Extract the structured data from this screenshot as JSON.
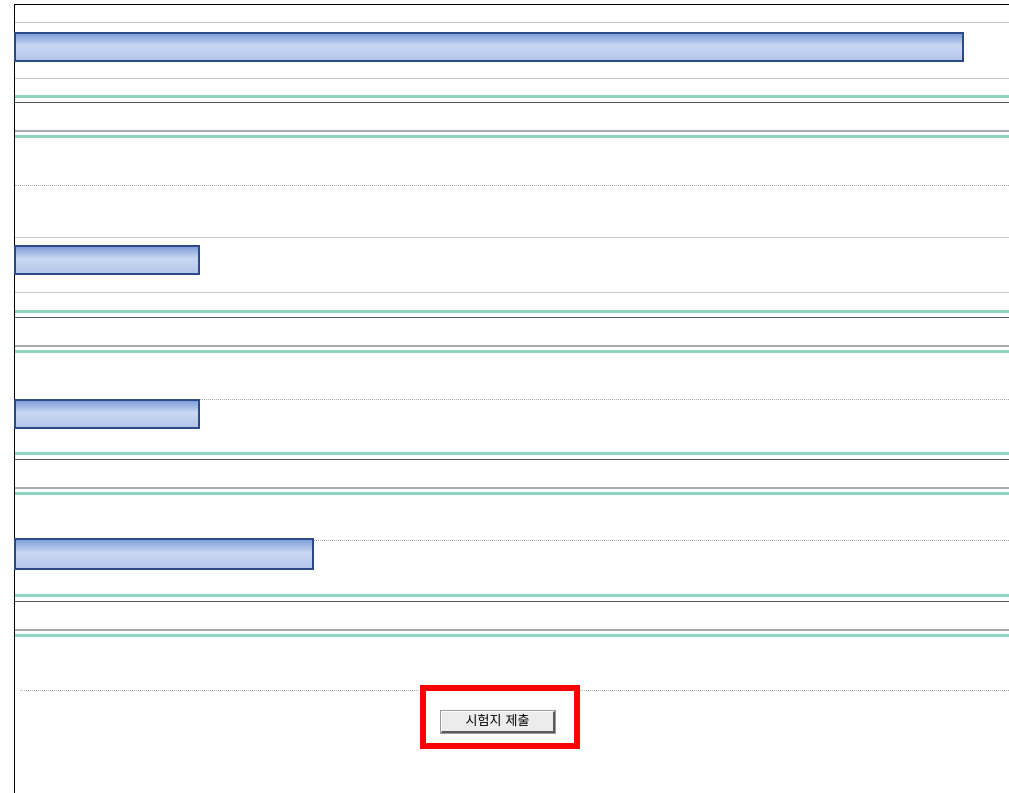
{
  "exam_form": {
    "submit_label": "시험지 제출"
  },
  "colors": {
    "redaction_fill": "#b3c6ea",
    "redaction_border": "#2c4a8a",
    "divider_teal": "#8fd4bf",
    "highlight_red": "#ff0000"
  }
}
